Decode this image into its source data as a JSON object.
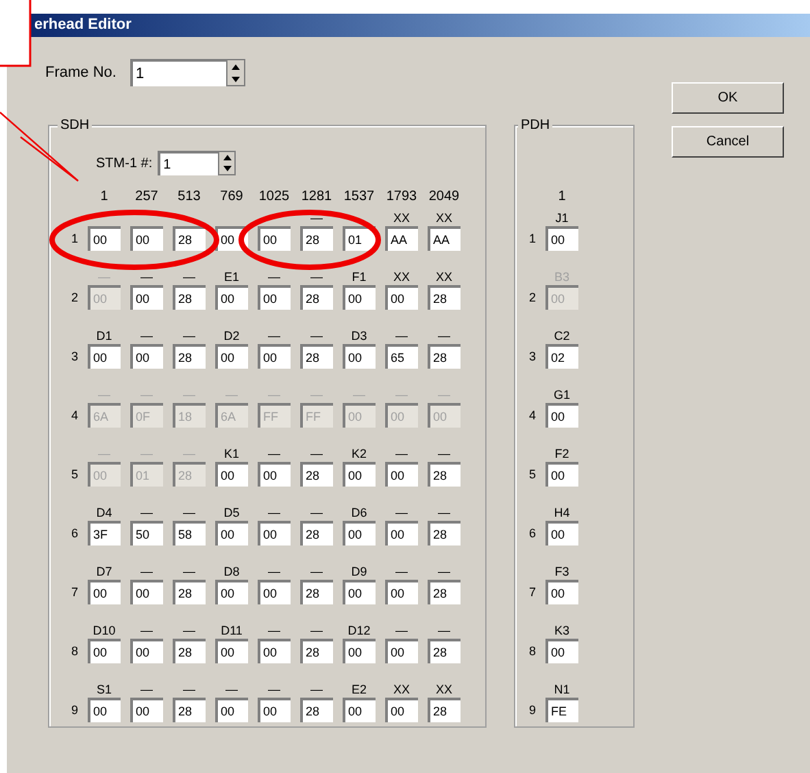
{
  "window": {
    "title": "erhead Editor"
  },
  "frame_no": {
    "label": "Frame No.",
    "value": "1"
  },
  "buttons": [
    {
      "label": "OK"
    },
    {
      "label": "Cancel"
    }
  ],
  "sdh": {
    "title": "SDH",
    "stm_label": "STM-1 #:",
    "stm_value": "1",
    "columns": [
      "1",
      "257",
      "513",
      "769",
      "1025",
      "1281",
      "1537",
      "1793",
      "2049"
    ],
    "rows": [
      {
        "number": "1",
        "cells": [
          {
            "value": "00",
            "disabled": false
          },
          {
            "value": "00",
            "disabled": false
          },
          {
            "value": "28",
            "disabled": false
          },
          {
            "value": "00",
            "disabled": false
          },
          {
            "value": "00",
            "disabled": false
          },
          {
            "label": "—",
            "value": "28",
            "disabled": false
          },
          {
            "value": "01",
            "disabled": false
          },
          {
            "label": "XX",
            "value": "AA",
            "disabled": false
          },
          {
            "label": "XX",
            "value": "AA",
            "disabled": false
          }
        ]
      },
      {
        "number": "2",
        "cells": [
          {
            "label": "—",
            "value": "00",
            "disabled": true
          },
          {
            "label": "—",
            "value": "00",
            "disabled": false
          },
          {
            "label": "—",
            "value": "28",
            "disabled": false
          },
          {
            "label": "E1",
            "value": "00",
            "disabled": false
          },
          {
            "label": "—",
            "value": "00",
            "disabled": false
          },
          {
            "label": "—",
            "value": "28",
            "disabled": false
          },
          {
            "label": "F1",
            "value": "00",
            "disabled": false
          },
          {
            "label": "XX",
            "value": "00",
            "disabled": false
          },
          {
            "label": "XX",
            "value": "28",
            "disabled": false
          }
        ]
      },
      {
        "number": "3",
        "cells": [
          {
            "label": "D1",
            "value": "00",
            "disabled": false
          },
          {
            "label": "—",
            "value": "00",
            "disabled": false
          },
          {
            "label": "—",
            "value": "28",
            "disabled": false
          },
          {
            "label": "D2",
            "value": "00",
            "disabled": false
          },
          {
            "label": "—",
            "value": "00",
            "disabled": false
          },
          {
            "label": "—",
            "value": "28",
            "disabled": false
          },
          {
            "label": "D3",
            "value": "00",
            "disabled": false
          },
          {
            "label": "—",
            "value": "65",
            "disabled": false
          },
          {
            "label": "—",
            "value": "28",
            "disabled": false
          }
        ]
      },
      {
        "number": "4",
        "cells": [
          {
            "label": "—",
            "value": "6A",
            "disabled": true
          },
          {
            "label": "—",
            "value": "0F",
            "disabled": true
          },
          {
            "label": "—",
            "value": "18",
            "disabled": true
          },
          {
            "label": "—",
            "value": "6A",
            "disabled": true
          },
          {
            "label": "—",
            "value": "FF",
            "disabled": true
          },
          {
            "label": "—",
            "value": "FF",
            "disabled": true
          },
          {
            "label": "—",
            "value": "00",
            "disabled": true
          },
          {
            "label": "—",
            "value": "00",
            "disabled": true
          },
          {
            "label": "—",
            "value": "00",
            "disabled": true
          }
        ]
      },
      {
        "number": "5",
        "cells": [
          {
            "label": "—",
            "value": "00",
            "disabled": true
          },
          {
            "label": "—",
            "value": "01",
            "disabled": true
          },
          {
            "label": "—",
            "value": "28",
            "disabled": true
          },
          {
            "label": "K1",
            "value": "00",
            "disabled": false
          },
          {
            "label": "—",
            "value": "00",
            "disabled": false
          },
          {
            "label": "—",
            "value": "28",
            "disabled": false
          },
          {
            "label": "K2",
            "value": "00",
            "disabled": false
          },
          {
            "label": "—",
            "value": "00",
            "disabled": false
          },
          {
            "label": "—",
            "value": "28",
            "disabled": false
          }
        ]
      },
      {
        "number": "6",
        "cells": [
          {
            "label": "D4",
            "value": "3F",
            "disabled": false
          },
          {
            "label": "—",
            "value": "50",
            "disabled": false
          },
          {
            "label": "—",
            "value": "58",
            "disabled": false
          },
          {
            "label": "D5",
            "value": "00",
            "disabled": false
          },
          {
            "label": "—",
            "value": "00",
            "disabled": false
          },
          {
            "label": "—",
            "value": "28",
            "disabled": false
          },
          {
            "label": "D6",
            "value": "00",
            "disabled": false
          },
          {
            "label": "—",
            "value": "00",
            "disabled": false
          },
          {
            "label": "—",
            "value": "28",
            "disabled": false
          }
        ]
      },
      {
        "number": "7",
        "cells": [
          {
            "label": "D7",
            "value": "00",
            "disabled": false
          },
          {
            "label": "—",
            "value": "00",
            "disabled": false
          },
          {
            "label": "—",
            "value": "28",
            "disabled": false
          },
          {
            "label": "D8",
            "value": "00",
            "disabled": false
          },
          {
            "label": "—",
            "value": "00",
            "disabled": false
          },
          {
            "label": "—",
            "value": "28",
            "disabled": false
          },
          {
            "label": "D9",
            "value": "00",
            "disabled": false
          },
          {
            "label": "—",
            "value": "00",
            "disabled": false
          },
          {
            "label": "—",
            "value": "28",
            "disabled": false
          }
        ]
      },
      {
        "number": "8",
        "cells": [
          {
            "label": "D10",
            "value": "00",
            "disabled": false
          },
          {
            "label": "—",
            "value": "00",
            "disabled": false
          },
          {
            "label": "—",
            "value": "28",
            "disabled": false
          },
          {
            "label": "D11",
            "value": "00",
            "disabled": false
          },
          {
            "label": "—",
            "value": "00",
            "disabled": false
          },
          {
            "label": "—",
            "value": "28",
            "disabled": false
          },
          {
            "label": "D12",
            "value": "00",
            "disabled": false
          },
          {
            "label": "—",
            "value": "00",
            "disabled": false
          },
          {
            "label": "—",
            "value": "28",
            "disabled": false
          }
        ]
      },
      {
        "number": "9",
        "cells": [
          {
            "label": "S1",
            "value": "00",
            "disabled": false
          },
          {
            "label": "—",
            "value": "00",
            "disabled": false
          },
          {
            "label": "—",
            "value": "28",
            "disabled": false
          },
          {
            "label": "—",
            "value": "00",
            "disabled": false
          },
          {
            "label": "—",
            "value": "00",
            "disabled": false
          },
          {
            "label": "—",
            "value": "28",
            "disabled": false
          },
          {
            "label": "E2",
            "value": "00",
            "disabled": false
          },
          {
            "label": "XX",
            "value": "00",
            "disabled": false
          },
          {
            "label": "XX",
            "value": "28",
            "disabled": false
          }
        ]
      }
    ]
  },
  "pdh": {
    "title": "PDH",
    "column": "1",
    "rows": [
      {
        "number": "1",
        "label": "J1",
        "value": "00",
        "disabled": false
      },
      {
        "number": "2",
        "label": "B3",
        "value": "00",
        "disabled": true
      },
      {
        "number": "3",
        "label": "C2",
        "value": "02",
        "disabled": false
      },
      {
        "number": "4",
        "label": "G1",
        "value": "00",
        "disabled": false
      },
      {
        "number": "5",
        "label": "F2",
        "value": "00",
        "disabled": false
      },
      {
        "number": "6",
        "label": "H4",
        "value": "00",
        "disabled": false
      },
      {
        "number": "7",
        "label": "F3",
        "value": "00",
        "disabled": false
      },
      {
        "number": "8",
        "label": "K3",
        "value": "00",
        "disabled": false
      },
      {
        "number": "9",
        "label": "N1",
        "value": "FE",
        "disabled": false
      }
    ]
  }
}
